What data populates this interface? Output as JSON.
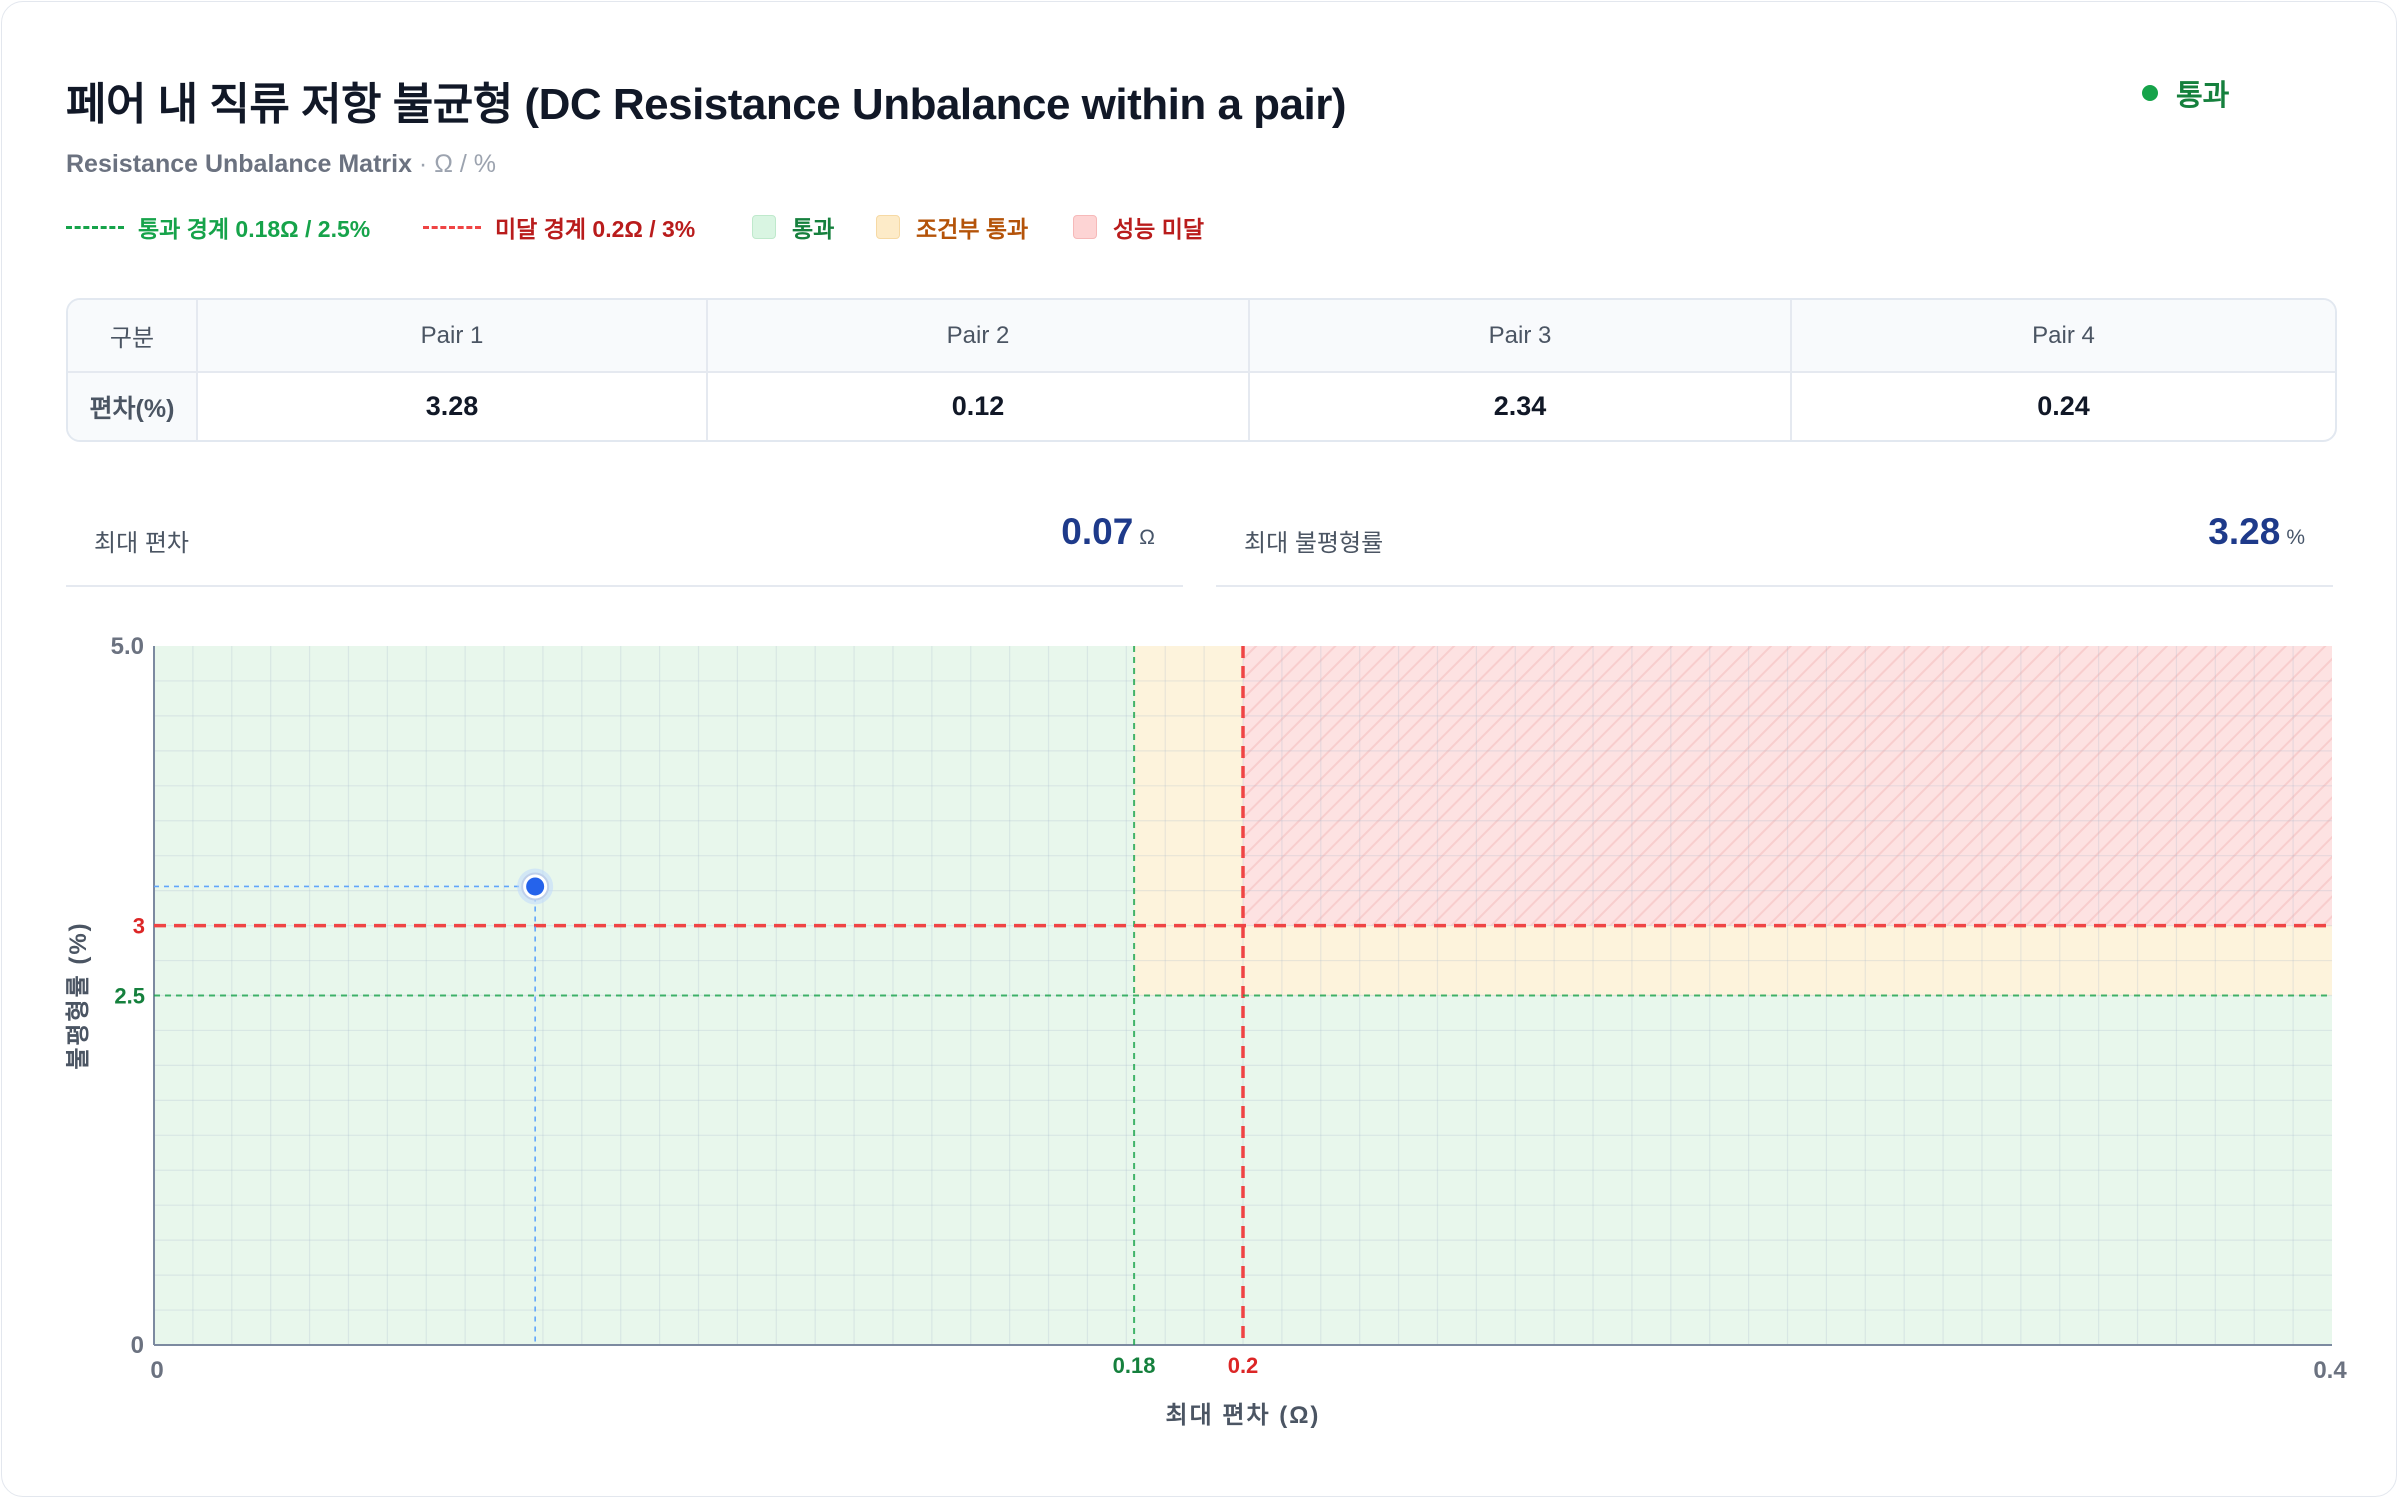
{
  "header": {
    "title": "페어 내 직류 저항 불균형 (DC Resistance Unbalance within a pair)",
    "subtitle": "Resistance Unbalance Matrix",
    "unit_suffix": " · Ω / %",
    "status": "통과"
  },
  "legend": {
    "pass_line": "통과 경계 0.18Ω / 2.5%",
    "fail_line": "미달 경계 0.2Ω / 3%",
    "pass_zone": "통과",
    "cond_zone": "조건부 통과",
    "fail_zone": "성능 미달"
  },
  "table": {
    "header_label": "구분",
    "row_label": "편차(%)",
    "columns": [
      "Pair 1",
      "Pair 2",
      "Pair 3",
      "Pair 4"
    ],
    "values": [
      "3.28",
      "0.12",
      "2.34",
      "0.24"
    ]
  },
  "metrics": {
    "max_deviation_label": "최대 편차",
    "max_deviation_value": "0.07",
    "max_deviation_unit": "Ω",
    "max_unbalance_label": "최대 불평형률",
    "max_unbalance_value": "3.28",
    "max_unbalance_unit": "%"
  },
  "colors": {
    "pass": "#16a34a",
    "fail": "#ef4444",
    "point": "#2563eb",
    "pass_zone": "#e8f7ec",
    "cond_zone": "#fdf3dc",
    "fail_zone": "#fde2e2"
  },
  "chart_data": {
    "type": "scatter",
    "xlabel": "최대 편차 (Ω)",
    "ylabel": "불평형률 (%)",
    "xlim": [
      0,
      0.4
    ],
    "ylim": [
      0,
      5.0
    ],
    "x_ticks": [
      "0",
      "0.4"
    ],
    "y_ticks": [
      "0",
      "5.0"
    ],
    "x_thresholds": [
      {
        "value": 0.18,
        "label": "0.18",
        "kind": "pass"
      },
      {
        "value": 0.2,
        "label": "0.2",
        "kind": "fail"
      }
    ],
    "y_thresholds": [
      {
        "value": 2.5,
        "label": "2.5",
        "kind": "pass"
      },
      {
        "value": 3,
        "label": "3",
        "kind": "fail"
      }
    ],
    "point": {
      "x": 0.07,
      "y": 3.28
    },
    "grid": true
  }
}
